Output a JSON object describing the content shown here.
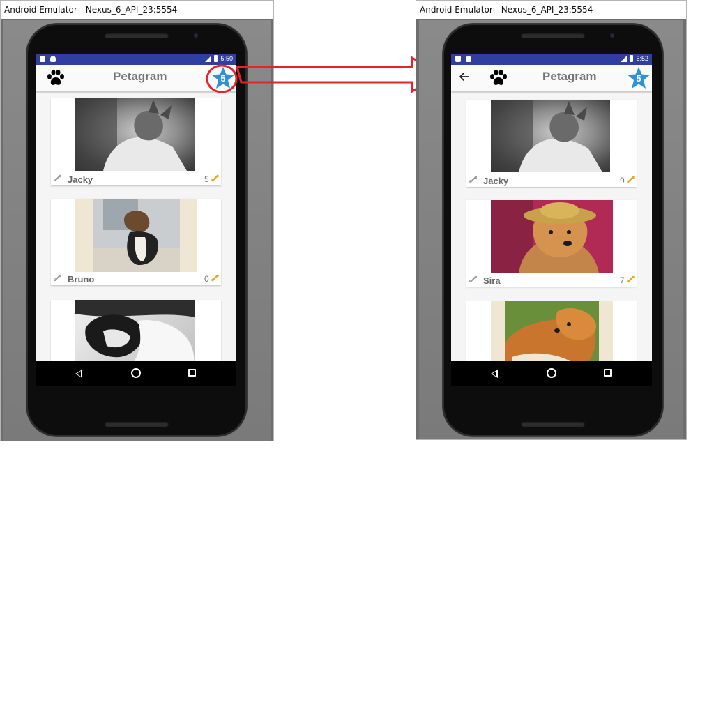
{
  "left_window": {
    "title": "Android Emulator - Nexus_6_API_23:5554",
    "status_time": "5:50",
    "app_title": "Petagram",
    "favorites_count": "5",
    "cards": [
      {
        "name": "Jacky",
        "count": "5",
        "photo": "gray-dog-in-blanket"
      },
      {
        "name": "Bruno",
        "count": "0",
        "photo": "beagle-sitting"
      },
      {
        "name": "",
        "count": "",
        "photo": "sleeping-bulldog"
      }
    ]
  },
  "right_window": {
    "title": "Android Emulator - Nexus_6_API_23:5554",
    "status_time": "5:52",
    "app_title": "Petagram",
    "favorites_count": "5",
    "cards": [
      {
        "name": "Jacky",
        "count": "9",
        "photo": "gray-dog-in-blanket"
      },
      {
        "name": "Sira",
        "count": "7",
        "photo": "dog-with-straw-hat"
      },
      {
        "name": "",
        "count": "",
        "photo": "fluffy-orange-dog"
      }
    ]
  },
  "icons": {
    "app_logo": "paw-icon",
    "favorites": "star-icon",
    "like": "bone-icon",
    "back": "arrow-back-icon"
  },
  "colors": {
    "status_bar": "#303f9f",
    "star": "#2f92d8",
    "annotation_red": "#e3242b",
    "bone_gold": "#e6a820"
  }
}
